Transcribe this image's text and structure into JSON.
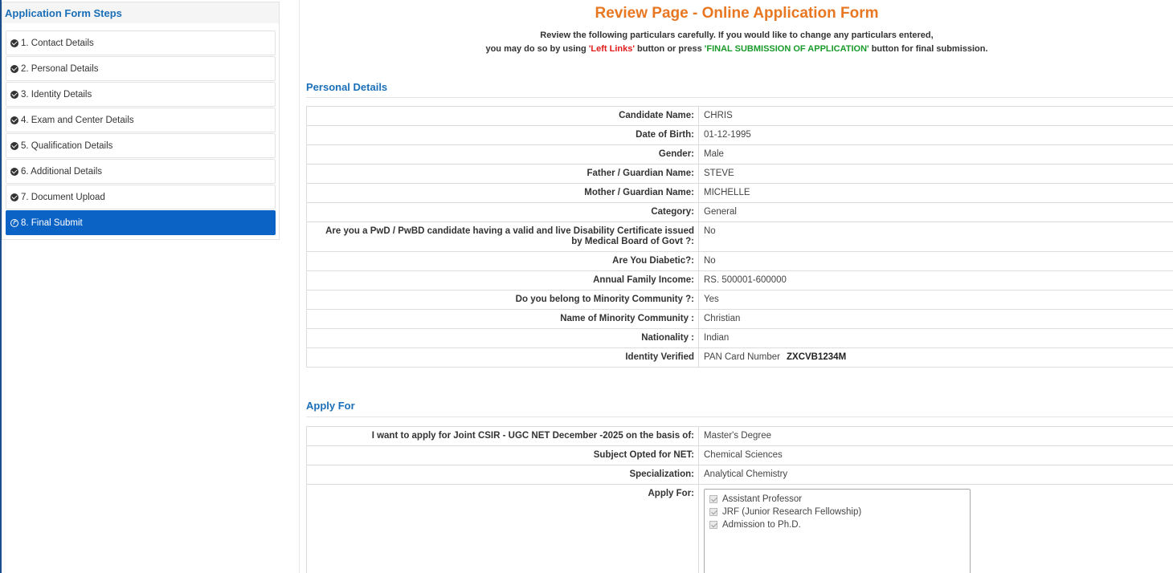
{
  "sidebar": {
    "title": "Application Form Steps",
    "steps": [
      {
        "label": "1. Contact Details"
      },
      {
        "label": "2. Personal Details"
      },
      {
        "label": "3. Identity Details"
      },
      {
        "label": "4. Exam and Center Details"
      },
      {
        "label": "5. Qualification Details"
      },
      {
        "label": "6. Additional Details"
      },
      {
        "label": "7. Document Upload"
      },
      {
        "label": "8. Final Submit"
      }
    ]
  },
  "main": {
    "title": "Review Page - Online Application Form",
    "instructions": {
      "line1": "Review the following particulars carefully. If you would like to change any particulars entered,",
      "line2_prefix": "you may do so by using ",
      "line2_left_links": "'Left Links'",
      "line2_middle": " button or press ",
      "line2_final": "'FINAL SUBMISSION OF APPLICATION'",
      "line2_suffix": " button for final submission."
    },
    "personal": {
      "title": "Personal Details",
      "rows": [
        {
          "label": "Candidate Name:",
          "value": "CHRIS"
        },
        {
          "label": "Date of Birth:",
          "value": "01-12-1995"
        },
        {
          "label": "Gender:",
          "value": "Male"
        },
        {
          "label": "Father / Guardian Name:",
          "value": "STEVE"
        },
        {
          "label": "Mother / Guardian Name:",
          "value": "MICHELLE"
        },
        {
          "label": "Category:",
          "value": "General"
        },
        {
          "label": "Are you a PwD / PwBD candidate having a valid and live Disability Certificate issued by Medical Board of Govt ?:",
          "value": "No"
        },
        {
          "label": "Are You Diabetic?:",
          "value": "No"
        },
        {
          "label": "Annual Family Income:",
          "value": "RS. 500001-600000"
        },
        {
          "label": "Do you belong to Minority Community ?:",
          "value": "Yes"
        },
        {
          "label": "Name of Minority Community :",
          "value": "Christian"
        },
        {
          "label": "Nationality :",
          "value": "Indian"
        }
      ],
      "identity": {
        "label": "Identity Verified",
        "type": "PAN Card Number",
        "number": "ZXCVB1234M"
      }
    },
    "apply": {
      "title": "Apply For",
      "rows": [
        {
          "label": "I want to apply for Joint CSIR - UGC NET December -2025 on the basis of:",
          "value": "Master's Degree"
        },
        {
          "label": "Subject Opted for NET:",
          "value": "Chemical Sciences"
        },
        {
          "label": "Specialization:",
          "value": "Analytical Chemistry"
        }
      ],
      "apply_for_label": "Apply For:",
      "options": [
        {
          "label": "Assistant Professor"
        },
        {
          "label": "JRF (Junior Research Fellowship)"
        },
        {
          "label": "Admission to Ph.D."
        }
      ]
    }
  }
}
